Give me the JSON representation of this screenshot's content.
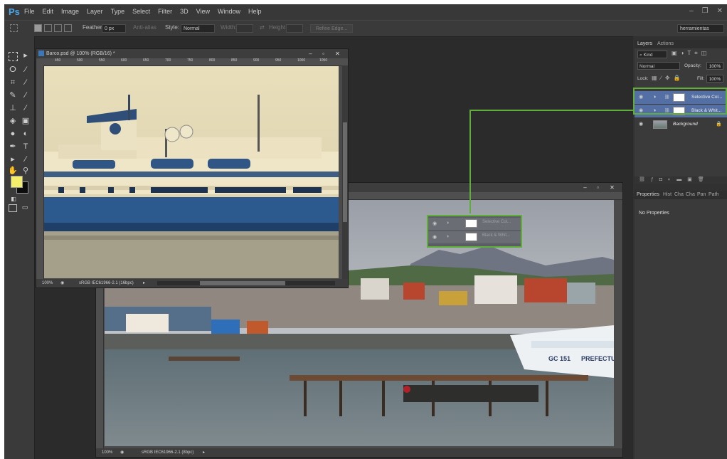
{
  "app": {
    "logo": "Ps",
    "menu": [
      "File",
      "Edit",
      "Image",
      "Layer",
      "Type",
      "Select",
      "Filter",
      "3D",
      "View",
      "Window",
      "Help"
    ]
  },
  "window_controls": [
    "–",
    "❐",
    "✕"
  ],
  "options": {
    "feather_label": "Feather:",
    "feather_value": "0 px",
    "antialias_label": "Anti-alias",
    "style_label": "Style:",
    "style_value": "Normal",
    "width_label": "Width:",
    "height_label": "Height:",
    "refine_label": "Refine Edge...",
    "workspace": "herramientas"
  },
  "doc_barco": {
    "title": "Barco.psd @ 100% (RGB/16) *",
    "ruler_ticks": [
      "450",
      "500",
      "550",
      "600",
      "650",
      "700",
      "750",
      "800",
      "850",
      "900",
      "950",
      "1000",
      "1050"
    ],
    "zoom": "100%",
    "profile": "sRGB IEC61966-2.1 (16bpc)"
  },
  "doc_harbor": {
    "zoom": "100%",
    "profile": "sRGB IEC61966-2.1 (8bpc)",
    "callout_layers": [
      "Selective Col...",
      "Black & Whit..."
    ]
  },
  "boat": {
    "code": "GC 151",
    "name": "PREFECTU"
  },
  "layers_panel": {
    "tabs": [
      "Layers",
      "Actions"
    ],
    "kind": "Kind",
    "blend_mode": "Normal",
    "opacity_label": "Opacity:",
    "opacity_value": "100%",
    "lock_label": "Lock:",
    "fill_label": "Fill:",
    "fill_value": "100%",
    "layers": [
      {
        "name": "Selective Col...",
        "selected": true
      },
      {
        "name": "Black & Whit...",
        "selected": true
      },
      {
        "name": "Background",
        "selected": false
      }
    ]
  },
  "properties_panel": {
    "tabs": [
      "Properties",
      "Hist",
      "Cha",
      "Cha",
      "Pan",
      "Path"
    ],
    "message": "No Properties"
  },
  "accent": {
    "callout": "#5fae3a",
    "layer_selected": "#536fa3",
    "foreground": "#f3ef6a"
  }
}
